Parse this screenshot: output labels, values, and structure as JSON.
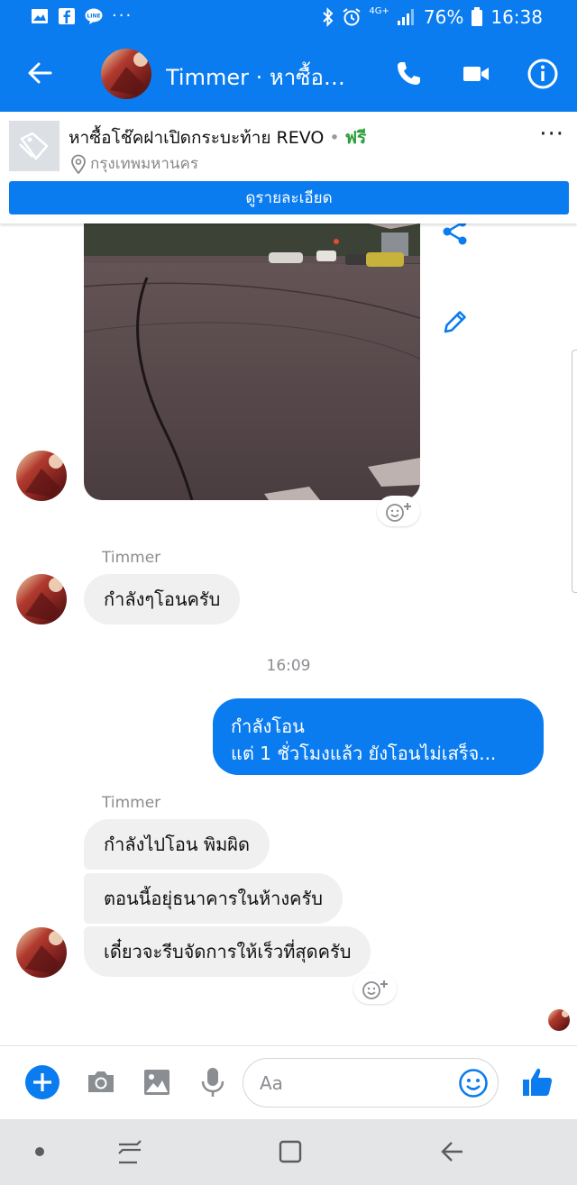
{
  "status_bar": {
    "left_icons": [
      "gallery-icon",
      "facebook-icon",
      "line-icon"
    ],
    "more": "···",
    "network": "4G+",
    "battery": "76%",
    "time": "16:38"
  },
  "header": {
    "title": "Timmer · หาซื้อโช๊คฝาเปิดกระบะท้าย REVO",
    "icons": [
      "back-arrow-icon",
      "phone-icon",
      "video-camera-icon",
      "info-icon"
    ]
  },
  "listing": {
    "title": "หาซื้อโช๊คฝาเปิดกระบะท้าย REVO",
    "separator": "•",
    "price": "ฟรี",
    "location": "กรุงเทพมหานคร",
    "more": "···",
    "detail_button": "ดูรายละเอียด"
  },
  "conversation": {
    "messages": [
      {
        "type": "image",
        "from": "Timmer"
      },
      {
        "sender": "Timmer",
        "text": "กำลังๆโอนครับ"
      },
      {
        "timestamp": "16:09"
      },
      {
        "from": "me",
        "lines": [
          "กำลังโอน",
          "แต่ 1 ชั่วโมงแล้ว ยังโอนไม่เสร็จ..."
        ]
      },
      {
        "sender": "Timmer",
        "group": [
          "กำลังไปโอน พิมผิด",
          "ตอนนี้อยุ่ธนาคารในห้างครับ",
          "เดี๋ยวจะรีบจัดการให้เร็วที่สุดครับ"
        ]
      }
    ]
  },
  "composer": {
    "placeholder": "Aa",
    "icons": [
      "plus-icon",
      "camera-icon",
      "image-icon",
      "microphone-icon",
      "emoji-icon",
      "thumbs-up-icon"
    ]
  },
  "nav_bar": {
    "icons": [
      "home-dot-icon",
      "recent-apps-icon",
      "home-icon",
      "back-icon"
    ]
  },
  "colors": {
    "accent": "#0a7cf0",
    "incoming_bubble": "#f0f0f0",
    "price_green": "#2aa03a",
    "secondary_text": "#8a8d91"
  }
}
